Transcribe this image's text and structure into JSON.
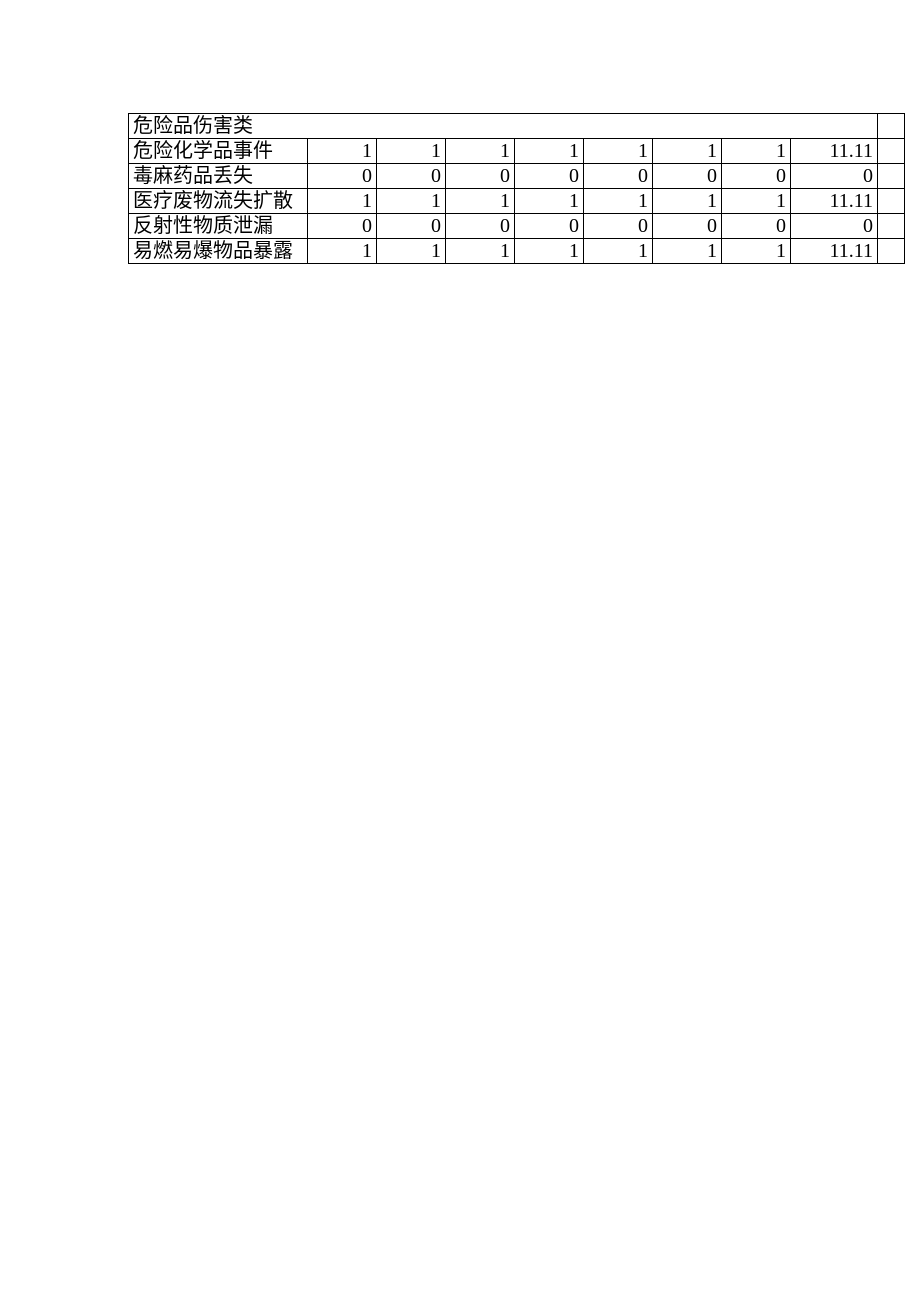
{
  "chart_data": {
    "type": "table",
    "category_header": "危险品伤害类",
    "rows": [
      {
        "label": "危险化学品事件",
        "values": [
          "1",
          "1",
          "1",
          "1",
          "1",
          "1",
          "1",
          "11.11"
        ]
      },
      {
        "label": "毒麻药品丢失",
        "values": [
          "0",
          "0",
          "0",
          "0",
          "0",
          "0",
          "0",
          "0"
        ]
      },
      {
        "label": "医疗废物流失扩散",
        "values": [
          "1",
          "1",
          "1",
          "1",
          "1",
          "1",
          "1",
          "11.11"
        ]
      },
      {
        "label": "反射性物质泄漏",
        "values": [
          "0",
          "0",
          "0",
          "0",
          "0",
          "0",
          "0",
          "0"
        ]
      },
      {
        "label": "易燃易爆物品暴露",
        "values": [
          "1",
          "1",
          "1",
          "1",
          "1",
          "1",
          "1",
          "11.11"
        ]
      }
    ]
  }
}
